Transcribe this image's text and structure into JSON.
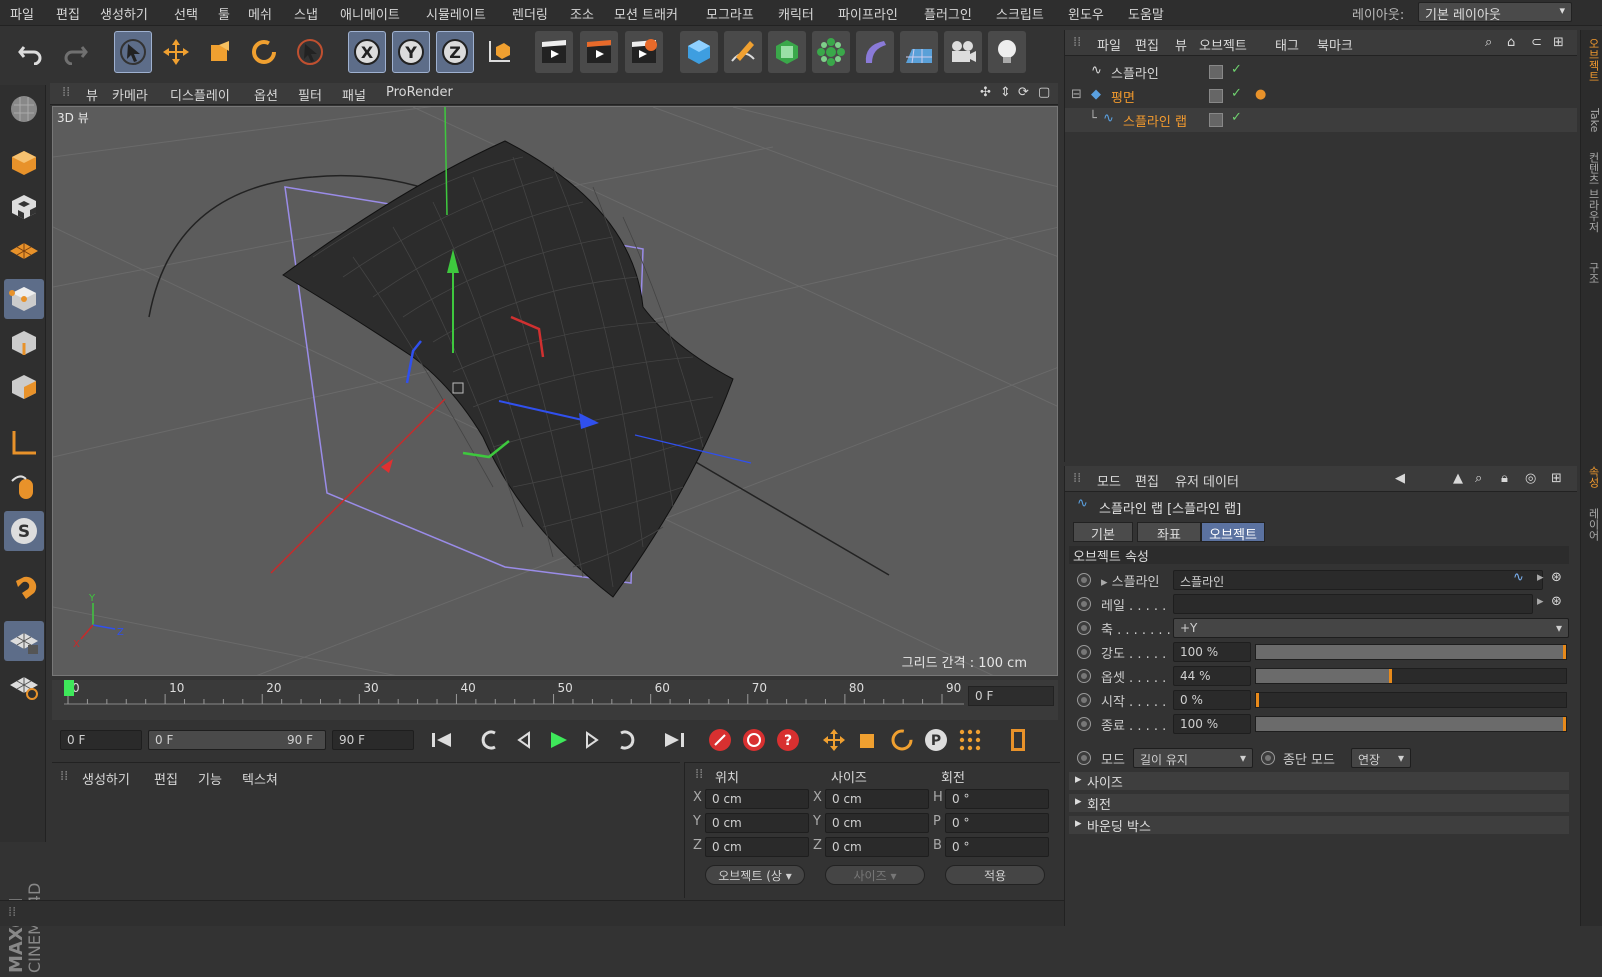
{
  "menubar": {
    "items": [
      "파일",
      "편집",
      "생성하기",
      "선택",
      "툴",
      "메쉬",
      "스냅",
      "애니메이트",
      "시뮬레이트",
      "렌더링",
      "조소",
      "모션 트래커",
      "모그라프",
      "캐릭터",
      "파이프라인",
      "플러그인",
      "스크립트",
      "윈도우",
      "도움말"
    ],
    "layout_label": "레이아웃:",
    "layout_value": "기본 레이아웃"
  },
  "viewport": {
    "menu": [
      "뷰",
      "카메라",
      "디스플레이",
      "옵션",
      "필터",
      "패널",
      "ProRender"
    ],
    "label": "3D 뷰",
    "grid_label": "그리드 간격 : 100 cm",
    "axis_x": "X",
    "axis_y": "Y",
    "axis_z": "Z"
  },
  "timeline": {
    "ticks": [
      "0",
      "10",
      "20",
      "30",
      "40",
      "50",
      "60",
      "70",
      "80",
      "90"
    ],
    "current_frame": "0 F",
    "start": "0 F",
    "range_start": "0 F",
    "range_end": "90 F",
    "end": "90 F"
  },
  "material": {
    "menu": [
      "생성하기",
      "편집",
      "기능",
      "텍스쳐"
    ]
  },
  "coords": {
    "headers": [
      "위치",
      "사이즈",
      "회전"
    ],
    "pos": {
      "x": "0 cm",
      "y": "0 cm",
      "z": "0 cm"
    },
    "size": {
      "x": "0 cm",
      "y": "0 cm",
      "z": "0 cm"
    },
    "rot": {
      "h": "0 °",
      "p": "0 °",
      "b": "0 °"
    },
    "labels": {
      "x": "X",
      "y": "Y",
      "z": "Z",
      "h": "H",
      "p": "P",
      "b": "B"
    },
    "mode_select": "오브젝트 (상",
    "size_select": "사이즈",
    "apply": "적용"
  },
  "objects": {
    "menu": [
      "파일",
      "편집",
      "뷰",
      "오브젝트",
      "태그",
      "북마크"
    ],
    "items": [
      {
        "name": "스플라인",
        "active": false
      },
      {
        "name": "평면",
        "active": true
      },
      {
        "name": "스플라인 랩",
        "active": true
      }
    ]
  },
  "attributes": {
    "menu": [
      "모드",
      "편집",
      "유저 데이터"
    ],
    "title": "스플라인 랩 [스플라인 랩]",
    "tabs": [
      "기본",
      "좌표",
      "오브젝트"
    ],
    "section": "오브젝트 속성",
    "rows": [
      {
        "label": "스플라인",
        "value": "스플라인"
      },
      {
        "label": "레일 . . . . .",
        "value": ""
      },
      {
        "label": "축 . . . . . . .",
        "value": "+Y"
      },
      {
        "label": "강도 . . . . .",
        "value": "100 %",
        "fraction": 1.0
      },
      {
        "label": "옵셋 . . . . .",
        "value": "44 %",
        "fraction": 0.44
      },
      {
        "label": "시작 . . . . .",
        "value": "0 %",
        "fraction": 0.0
      },
      {
        "label": "종료 . . . . .",
        "value": "100 %",
        "fraction": 1.0
      }
    ],
    "mode_label": "모드",
    "mode_value": "길이 유지",
    "end_mode_label": "종단 모드",
    "end_mode_value": "연장",
    "groups": [
      "사이즈",
      "회전",
      "바운딩 박스"
    ]
  },
  "side_tabs": [
    "오브젝트",
    "Take",
    "컨텐츠 브라우저",
    "구조",
    "속성",
    "레이어"
  ],
  "brand": {
    "maxon": "MAXON",
    "cinema": "CINEMA 4D"
  },
  "colors": {
    "accent": "#f29a2e",
    "selection": "#5d6d89"
  }
}
